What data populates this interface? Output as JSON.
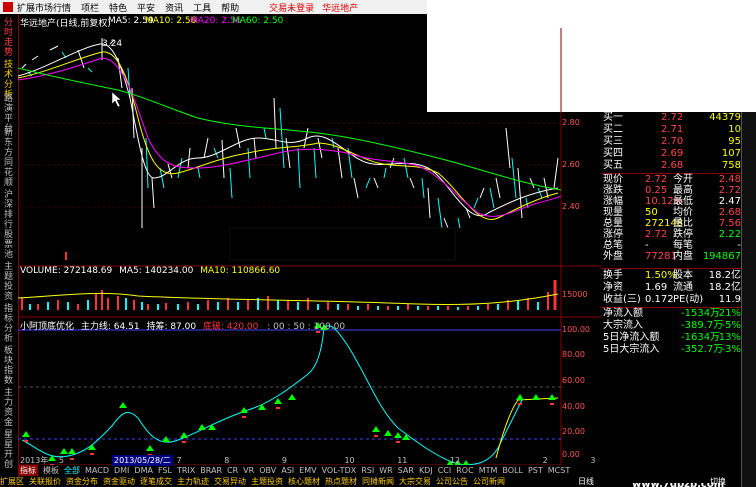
{
  "menubar": {
    "items": [
      "扩展市场行情",
      "项栏",
      "特色",
      "平安",
      "资讯",
      "工具",
      "帮助"
    ],
    "notice": "交易未登录",
    "stock": "华远地产"
  },
  "leftbar": {
    "tabs": [
      "分时走势",
      "技术分析",
      "路演平台",
      "新东方",
      "同花顺",
      "沪深排行",
      "股票池",
      "主题投资",
      "指标分析",
      "板块指数",
      "主力资金",
      "星星开创"
    ]
  },
  "main_chart": {
    "title": "华远地产(日线,前复权)",
    "ma5": "MA5: 2.59",
    "ma10": "MA10: 2.56",
    "ma20": "MA20: 2.56",
    "ma60": "MA60: 2.50",
    "high_label": "3.24",
    "y_ticks": [
      "2.80",
      "2.60",
      "2.40"
    ]
  },
  "volume_panel": {
    "label": "VOLUME: 272148.69",
    "ma5": "MA5: 140234.00",
    "ma10": "MA10: 110866.60",
    "y_tick": "15000"
  },
  "indicator_panel": {
    "name": "小阿顶底优化",
    "main": "主力线: 64.51",
    "hold": "持筹: 87.00",
    "break": "底破: 420.00",
    "levels": ": 00 : 50 : 100.00",
    "y_ticks": [
      "100.00",
      "80.00",
      "60.00",
      "40.00",
      "20.00",
      "0.00"
    ]
  },
  "date_axis": {
    "year": "2013年",
    "ticks": [
      "5",
      "7",
      "8",
      "9",
      "10",
      "11",
      "12",
      "2",
      "3"
    ],
    "selected": "2013/05/28/二"
  },
  "indicator_tabs": [
    "指标",
    "模板",
    "全部",
    "MACD",
    "DMI",
    "DMA",
    "FSL",
    "TRIX",
    "BRAR",
    "CR",
    "VR",
    "OBV",
    "ASI",
    "EMV",
    "VOL-TDX",
    "RSI",
    "WR",
    "SAR",
    "KDJ",
    "CCI",
    "ROC",
    "MTM",
    "BOLL",
    "PST",
    "MCST"
  ],
  "bottom_tabs": [
    "扩展区",
    "关联报价",
    "资金分布",
    "资金驱动",
    "逐笔成交",
    "主力轨迹",
    "交易异动",
    "主题投资",
    "核心题材",
    "热点题材",
    "同摊新闻",
    "大宗交易",
    "公司公告",
    "公司新闻"
  ],
  "quote": {
    "bids": [
      {
        "label": "买一",
        "price": "2.72",
        "vol": "44379"
      },
      {
        "label": "买二",
        "price": "2.71",
        "vol": "10"
      },
      {
        "label": "买三",
        "price": "2.70",
        "vol": "95"
      },
      {
        "label": "买四",
        "price": "2.69",
        "vol": "107"
      },
      {
        "label": "买五",
        "price": "2.68",
        "vol": "758"
      }
    ],
    "rows": [
      [
        "现价",
        "2.72",
        "今开",
        "2.48"
      ],
      [
        "涨跌",
        "0.25",
        "最高",
        "2.72"
      ],
      [
        "涨幅",
        "10.12%",
        "最低",
        "2.47"
      ],
      [
        "现量",
        "50",
        "均价",
        "2.68"
      ],
      [
        "总量",
        "272148",
        "量比",
        "7.56"
      ],
      [
        "涨停",
        "2.72",
        "跌停",
        "2.22"
      ],
      [
        "总笔",
        "-",
        "每笔",
        "-"
      ],
      [
        "外盘",
        "77281",
        "内盘",
        "194867"
      ],
      [
        "换手",
        "1.50%",
        "股本",
        "18.2亿"
      ],
      [
        "净资",
        "1.69",
        "流通",
        "18.2亿"
      ],
      [
        "收益(三)",
        "0.172",
        "PE(动)",
        "11.9"
      ]
    ],
    "flows": [
      [
        "净流入额",
        "-1534万",
        "-21%"
      ],
      [
        "大宗流入",
        "-389.7万",
        "-5%"
      ],
      [
        "5日净流入额",
        "-1634万",
        "-13%"
      ],
      [
        "5日大宗流入",
        "-352.7万",
        "-3%"
      ]
    ]
  },
  "footer": {
    "tab_left": "日线",
    "switch": "切换",
    "watermark": "www.7gpzb.com"
  }
}
